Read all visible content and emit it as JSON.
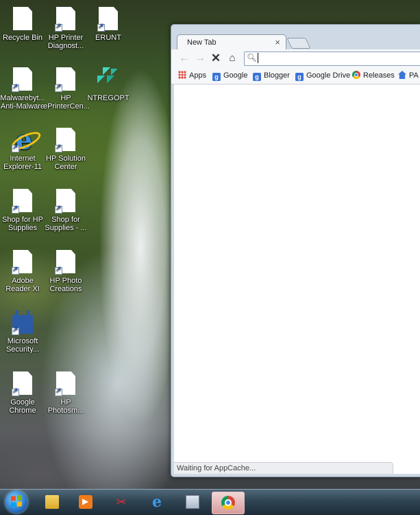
{
  "desktop": {
    "icons": [
      {
        "label": "Recycle Bin",
        "icon": "recycle-bin-icon"
      },
      {
        "label": "HP Printer Diagnost...",
        "icon": "document-shortcut-icon"
      },
      {
        "label": "ERUNT",
        "icon": "document-shortcut-icon"
      },
      {
        "label": "Malwarebyt... Anti-Malware",
        "icon": "document-shortcut-icon"
      },
      {
        "label": "HP ePrinterCen...",
        "icon": "document-shortcut-icon"
      },
      {
        "label": "NTREGOPT",
        "icon": "cubes-icon"
      },
      {
        "label": "Internet Explorer-11",
        "icon": "internet-explorer-icon"
      },
      {
        "label": "HP Solution Center",
        "icon": "document-shortcut-icon"
      },
      {
        "label": "Shop for HP Supplies",
        "icon": "document-shortcut-icon"
      },
      {
        "label": "Shop for Supplies - ...",
        "icon": "document-shortcut-icon"
      },
      {
        "label": "Adobe Reader XI",
        "icon": "document-shortcut-icon"
      },
      {
        "label": "HP Photo Creations",
        "icon": "document-shortcut-icon"
      },
      {
        "label": "Microsoft Security...",
        "icon": "security-castle-icon"
      },
      {
        "label": "Google Chrome",
        "icon": "document-shortcut-icon"
      },
      {
        "label": "HP Photosm...",
        "icon": "document-shortcut-icon"
      }
    ]
  },
  "browser": {
    "tab_title": "New Tab",
    "tab_close": "×",
    "omnibox_value": "",
    "bookmarks": [
      {
        "label": "Apps",
        "icon": "apps-grid-icon"
      },
      {
        "label": "Google",
        "icon": "google-icon"
      },
      {
        "label": "Blogger",
        "icon": "google-icon"
      },
      {
        "label": "Google Drive",
        "icon": "google-icon"
      },
      {
        "label": "Releases",
        "icon": "chrome-icon"
      },
      {
        "label": "PA",
        "icon": "home-icon"
      }
    ],
    "status_text": "Waiting for AppCache..."
  },
  "taskbar": {
    "items": [
      "start-orb",
      "windows-explorer",
      "media-player",
      "snipping-tool",
      "internet-explorer",
      "calculator",
      "google-chrome"
    ],
    "active": "google-chrome"
  }
}
